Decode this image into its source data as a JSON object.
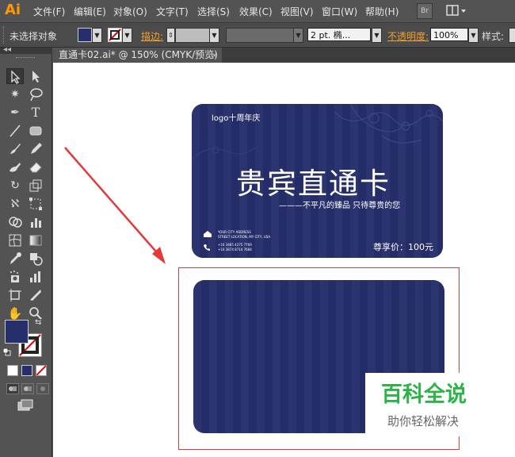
{
  "app": {
    "logo": "Ai"
  },
  "menubar": {
    "items": [
      "文件(F)",
      "编辑(E)",
      "对象(O)",
      "文字(T)",
      "选择(S)",
      "效果(C)",
      "视图(V)",
      "窗口(W)",
      "帮助(H)"
    ],
    "br_label": "Br"
  },
  "controlbar": {
    "no_selection": "未选择对象",
    "stroke_label": "描边:",
    "stroke_value": "",
    "brush_value": "2 pt. 椭...",
    "opacity_label": "不透明度:",
    "opacity_value": "100%",
    "style_label": "样式:"
  },
  "document": {
    "tab_title": "直通卡02.ai* @ 150% (CMYK/预览)",
    "close_glyph": "×"
  },
  "toolbar": {
    "tools": [
      "selection-icon",
      "direct-selection-icon",
      "magic-wand-icon",
      "lasso-icon",
      "pen-icon",
      "type-icon",
      "line-icon",
      "rectangle-icon",
      "paintbrush-icon",
      "pencil-icon",
      "blob-brush-icon",
      "eraser-icon",
      "rotate-icon",
      "scale-icon",
      "width-icon",
      "free-transform-icon",
      "shape-builder-icon",
      "graph-icon",
      "mesh-icon",
      "gradient-icon",
      "eyedropper-icon",
      "blend-icon",
      "symbol-sprayer-icon",
      "column-graph-icon",
      "artboard-icon",
      "slice-icon",
      "hand-icon",
      "zoom-icon"
    ],
    "fill_color": "#262f6b"
  },
  "card_front": {
    "logo_text": "logo十周年庆",
    "title": "贵宾直通卡",
    "slogan": "———不平凡的臻品 只待尊贵的您",
    "address_line1": "YOUR CITY ADDRESS",
    "address_line2": "STREET LOCATION, MY CITY, USA",
    "phone_line1": "+16 3485 4275 7769",
    "phone_line2": "+16 3874 8714 7684",
    "price": "尊享价：100元",
    "color": "#252e6a"
  },
  "card_back": {
    "color": "#252e6a"
  },
  "annotation": {
    "arrow_color": "#e23a3a",
    "box_color": "#e23a3a"
  },
  "watermark": {
    "title": "百科全说",
    "subtitle": "助你轻松解决",
    "title_color": "#2db34a"
  }
}
